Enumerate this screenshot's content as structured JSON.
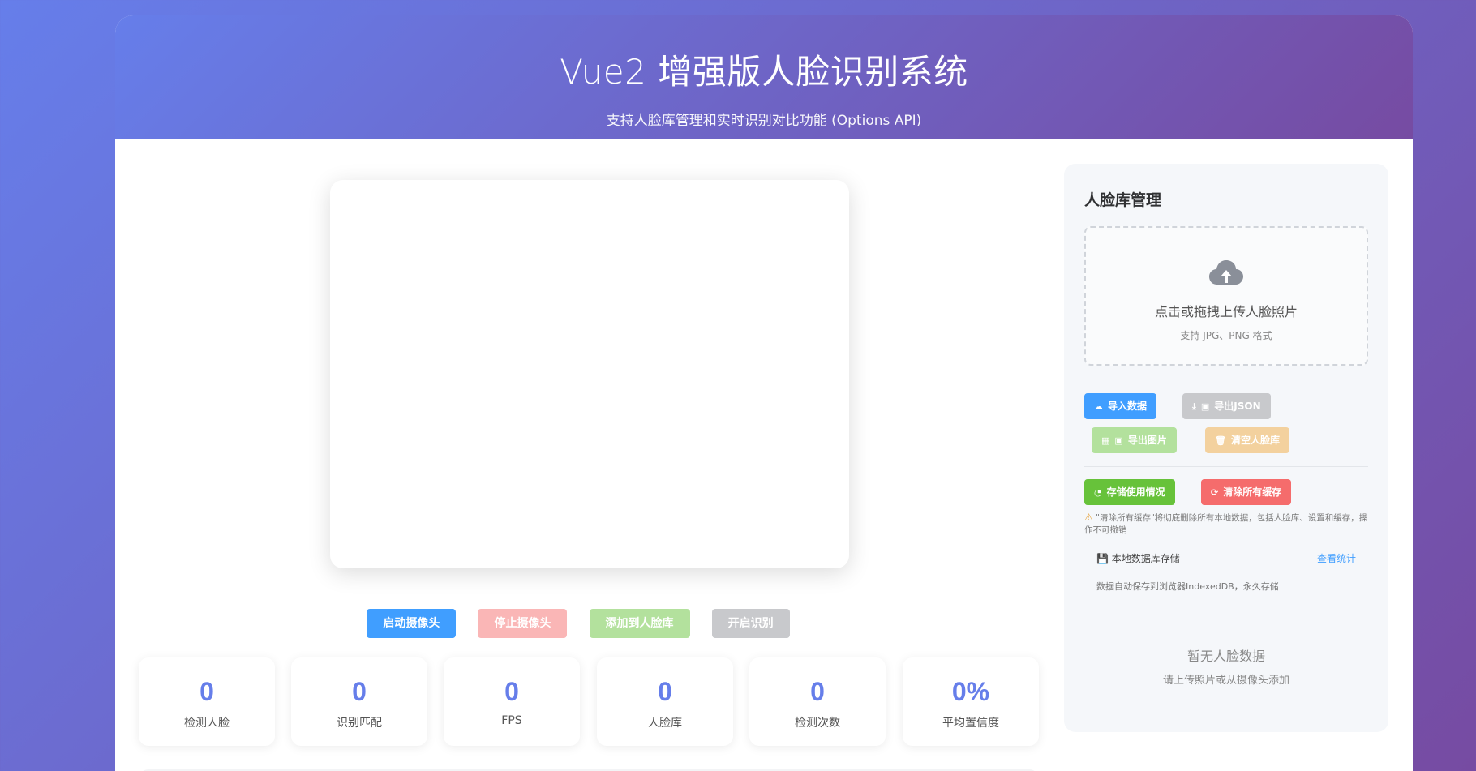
{
  "header": {
    "title": "Vue2 增强版人脸识别系统",
    "subtitle": "支持人脸库管理和实时识别对比功能 (Options API)"
  },
  "controls": {
    "start_camera": "启动摄像头",
    "stop_camera": "停止摄像头",
    "add_to_library": "添加到人脸库",
    "start_recognition": "开启识别"
  },
  "stats": [
    {
      "value": "0",
      "label": "检测人脸"
    },
    {
      "value": "0",
      "label": "识别匹配"
    },
    {
      "value": "0",
      "label": "FPS"
    },
    {
      "value": "0",
      "label": "人脸库"
    },
    {
      "value": "0",
      "label": "检测次数"
    },
    {
      "value": "0%",
      "label": "平均置信度"
    }
  ],
  "panel": {
    "title": "人脸库管理",
    "upload": {
      "primary_text": "点击或拖拽上传人脸照片",
      "secondary_text": "支持 JPG、PNG 格式"
    },
    "buttons": {
      "import_data": "导入数据",
      "export_json": "导出JSON",
      "export_images": "导出图片",
      "clear_library": "清空人脸库",
      "storage_usage": "存储使用情况",
      "clear_cache": "清除所有缓存"
    },
    "warning": "\"清除所有缓存\"将彻底删除所有本地数据，包括人脸库、设置和缓存，操作不可撤销",
    "db": {
      "title": "本地数据库存储",
      "view_stats": "查看统计",
      "description": "数据自动保存到浏览器IndexedDB，永久存储"
    },
    "empty": {
      "title": "暂无人脸数据",
      "hint": "请上传照片或从摄像头添加"
    }
  },
  "colors": {
    "gradient_start": "#667eea",
    "gradient_end": "#764ba2",
    "primary": "#409eff",
    "danger": "#f56c6c",
    "success": "#67c23a",
    "warning": "#e6a23c",
    "info": "#909399"
  }
}
